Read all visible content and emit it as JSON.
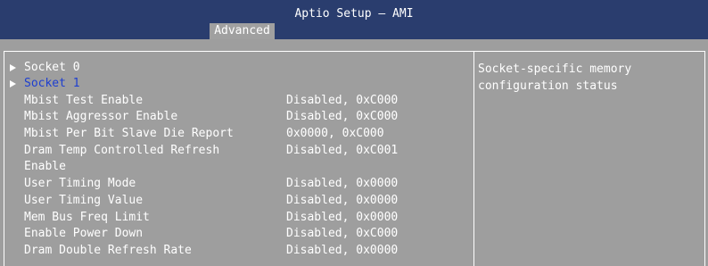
{
  "app_title": "Aptio Setup – AMI",
  "tab": {
    "label": "Advanced"
  },
  "submenus": [
    {
      "label": "Socket 0"
    },
    {
      "label": "Socket 1"
    }
  ],
  "settings": [
    {
      "label": "Mbist Test Enable",
      "value": "Disabled, 0xC000"
    },
    {
      "label": "Mbist Aggressor Enable",
      "value": "Disabled, 0xC000"
    },
    {
      "label": "Mbist Per Bit Slave Die Report",
      "value": "0x0000, 0xC000"
    },
    {
      "label": "Dram Temp Controlled Refresh",
      "label_line2": "Enable",
      "value": "Disabled, 0xC001"
    },
    {
      "label": "User Timing Mode",
      "value": "Disabled, 0x0000"
    },
    {
      "label": "User Timing Value",
      "value": "Disabled, 0x0000"
    },
    {
      "label": "Mem Bus Freq Limit",
      "value": "Disabled, 0x0000"
    },
    {
      "label": "Enable Power Down",
      "value": "Disabled, 0xC000"
    },
    {
      "label": "Dram Double Refresh Rate",
      "value": "Disabled, 0x0000"
    }
  ],
  "help": {
    "line1": "Socket-specific memory",
    "line2": "configuration status"
  },
  "colors": {
    "header_bg": "#2a3d6e",
    "panel_bg": "#9e9e9e",
    "highlight_text": "#1e3fd0",
    "text": "#ffffff"
  }
}
